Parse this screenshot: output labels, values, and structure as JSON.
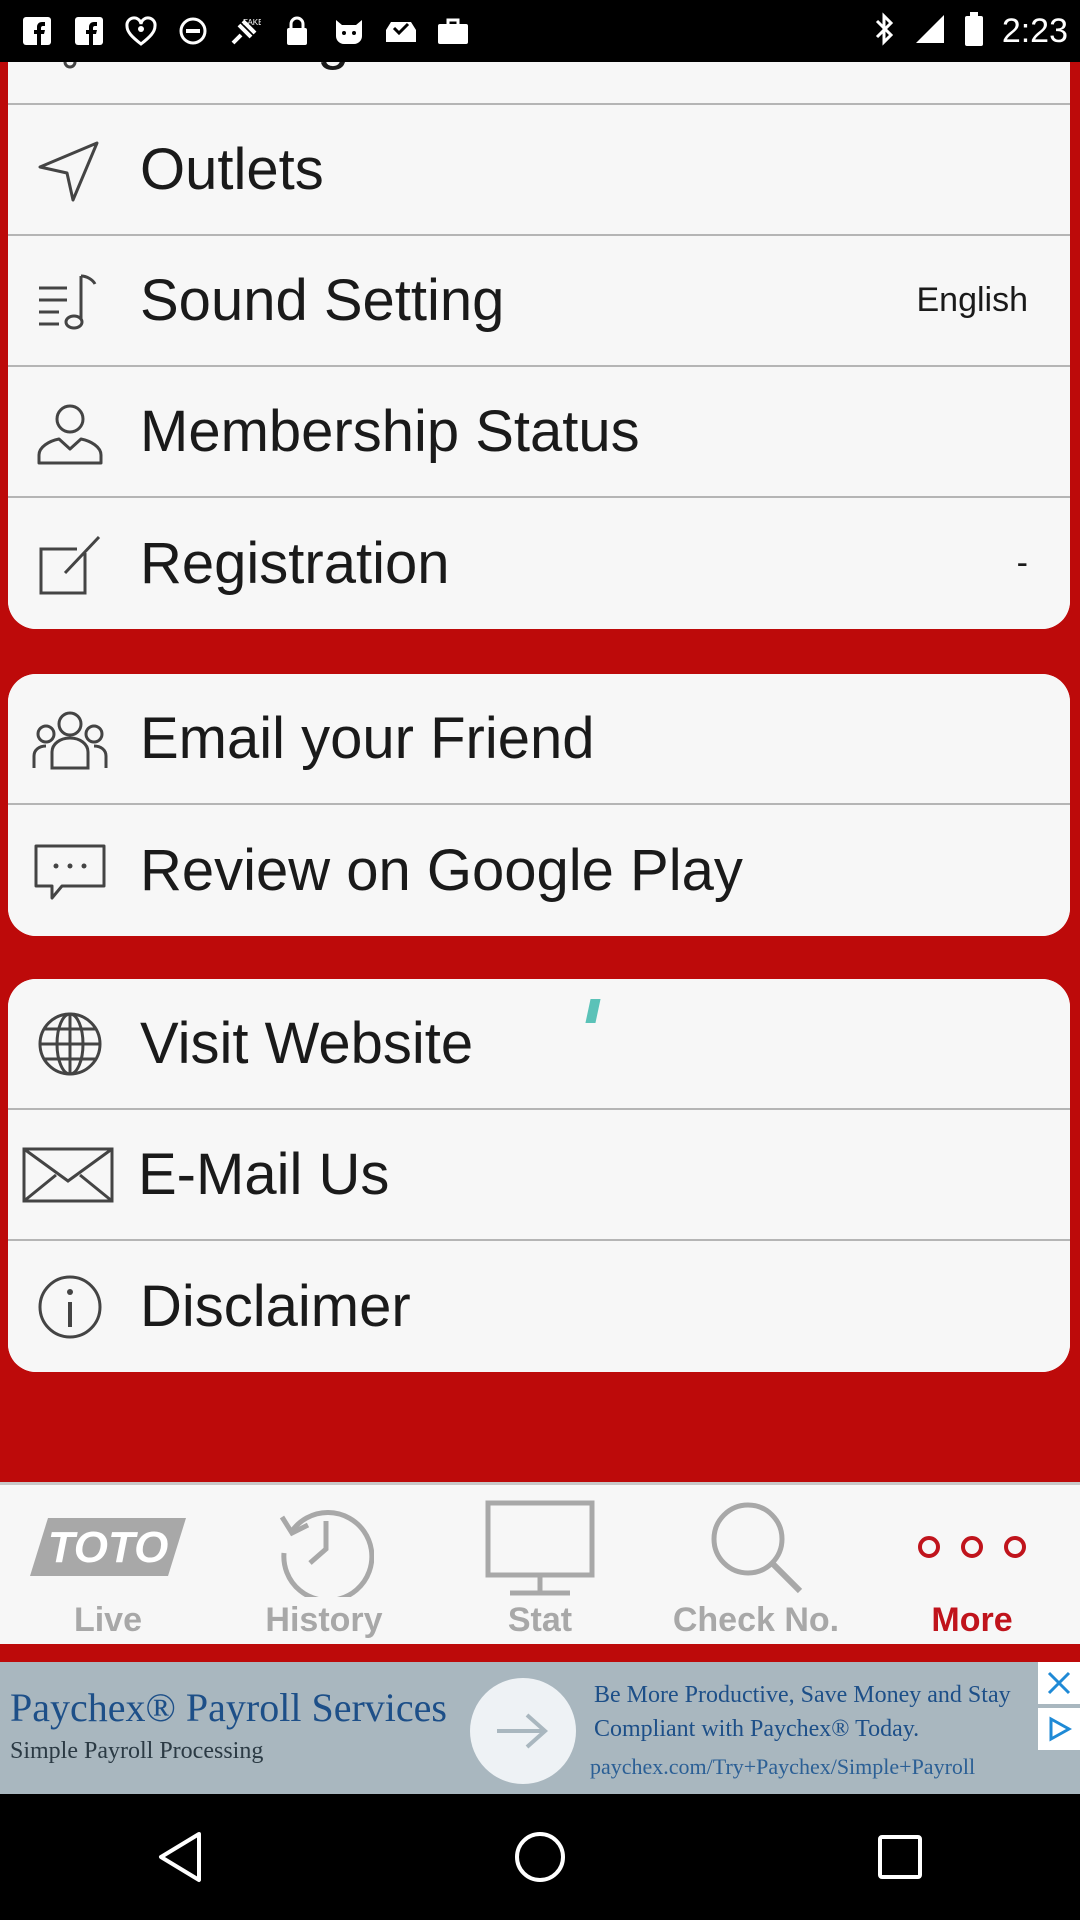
{
  "status_bar": {
    "time": "2:23",
    "left_icons": [
      "facebook-icon",
      "facebook-icon",
      "iheart-radio-icon",
      "target-icon",
      "fake-gps-icon",
      "lock-icon",
      "cat-icon",
      "inbox-check-icon",
      "briefcase-icon"
    ],
    "right_icons": [
      "bluetooth-icon",
      "signal-icon",
      "battery-icon"
    ]
  },
  "groups": [
    {
      "items": [
        {
          "label": "Winning Alert",
          "value": "",
          "icon": "bell-icon"
        },
        {
          "label": "Outlets",
          "value": "",
          "icon": "navigation-icon"
        },
        {
          "label": "Sound Setting",
          "value": "English",
          "icon": "music-list-icon"
        },
        {
          "label": "Membership Status",
          "value": "",
          "icon": "user-icon"
        },
        {
          "label": "Registration",
          "value": "-",
          "icon": "edit-icon"
        }
      ]
    },
    {
      "items": [
        {
          "label": "Email your Friend",
          "value": "",
          "icon": "group-icon"
        },
        {
          "label": "Review on Google Play",
          "value": "",
          "icon": "chat-bubble-icon"
        }
      ]
    },
    {
      "items": [
        {
          "label": "Visit Website",
          "value": "",
          "icon": "globe-icon"
        },
        {
          "label": "E-Mail Us",
          "value": "",
          "icon": "envelope-icon"
        },
        {
          "label": "Disclaimer",
          "value": "",
          "icon": "info-icon"
        }
      ]
    }
  ],
  "tabs": [
    {
      "label": "Live",
      "icon": "toto-logo-icon",
      "active": false,
      "logo_text": "TOTO"
    },
    {
      "label": "History",
      "icon": "clock-history-icon",
      "active": false
    },
    {
      "label": "Stat",
      "icon": "monitor-icon",
      "active": false
    },
    {
      "label": "Check No.",
      "icon": "search-icon",
      "active": false
    },
    {
      "label": "More",
      "icon": "more-dots-icon",
      "active": true
    }
  ],
  "ad": {
    "title": "Paychex® Payroll Services",
    "subtitle": "Simple Payroll Processing",
    "description": "Be More Productive, Save Money and Stay Compliant with Paychex® Today.",
    "url": "paychex.com/Try+Paychex/Simple+Payroll"
  },
  "colors": {
    "background_red": "#bd0a0a",
    "active_tab": "#c0141c",
    "inactive_tab": "#a8a8a8",
    "card": "#f7f7f7"
  }
}
